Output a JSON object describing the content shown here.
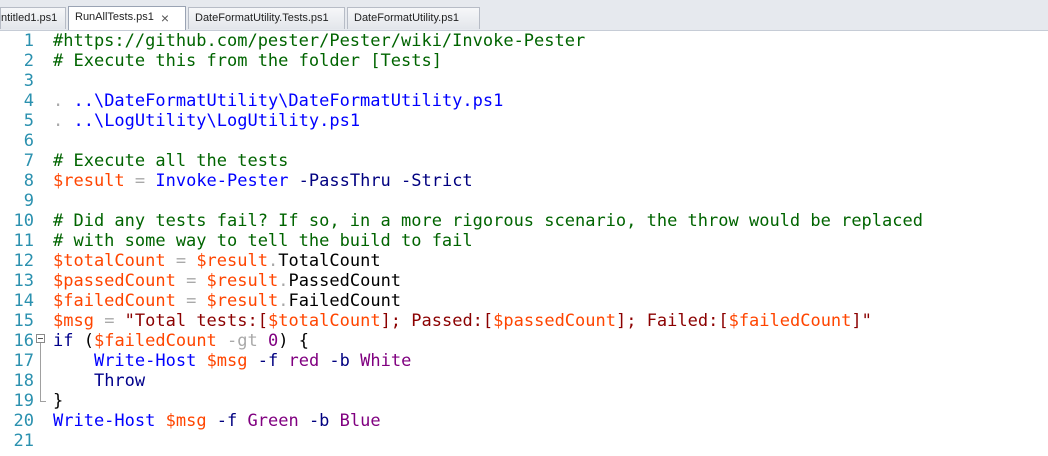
{
  "tabs": [
    {
      "label": "ntitled1.ps1",
      "active": false
    },
    {
      "label": "RunAllTests.ps1",
      "active": true,
      "close": "×"
    },
    {
      "label": "DateFormatUtility.Tests.ps1",
      "active": false
    },
    {
      "label": "DateFormatUtility.ps1",
      "active": false
    }
  ],
  "editor": {
    "lines": [
      {
        "n": "1",
        "tokens": [
          {
            "t": "#https://github.com/pester/Pester/wiki/Invoke-Pester",
            "c": "comment"
          }
        ]
      },
      {
        "n": "2",
        "tokens": [
          {
            "t": "# Execute this from the folder [Tests]",
            "c": "comment"
          }
        ]
      },
      {
        "n": "3",
        "tokens": []
      },
      {
        "n": "4",
        "tokens": [
          {
            "t": ". ",
            "c": "op"
          },
          {
            "t": "..\\DateFormatUtility\\DateFormatUtility.ps1",
            "c": "cmd"
          }
        ]
      },
      {
        "n": "5",
        "tokens": [
          {
            "t": ". ",
            "c": "op"
          },
          {
            "t": "..\\LogUtility\\LogUtility.ps1",
            "c": "cmd"
          }
        ]
      },
      {
        "n": "6",
        "tokens": []
      },
      {
        "n": "7",
        "tokens": [
          {
            "t": "# Execute all the tests",
            "c": "comment"
          }
        ]
      },
      {
        "n": "8",
        "tokens": [
          {
            "t": "$result",
            "c": "var"
          },
          {
            "t": " = ",
            "c": "op"
          },
          {
            "t": "Invoke-Pester",
            "c": "cmd"
          },
          {
            "t": " -PassThru -Strict",
            "c": "param"
          }
        ]
      },
      {
        "n": "9",
        "tokens": []
      },
      {
        "n": "10",
        "tokens": [
          {
            "t": "# Did any tests fail? If so, in a more rigorous scenario, the throw would be replaced",
            "c": "comment"
          }
        ]
      },
      {
        "n": "11",
        "tokens": [
          {
            "t": "# with some way to tell the build to fail",
            "c": "comment"
          }
        ]
      },
      {
        "n": "12",
        "tokens": [
          {
            "t": "$totalCount",
            "c": "var"
          },
          {
            "t": " = ",
            "c": "op"
          },
          {
            "t": "$result",
            "c": "var"
          },
          {
            "t": ".",
            "c": "op"
          },
          {
            "t": "TotalCount",
            "c": "member"
          }
        ]
      },
      {
        "n": "13",
        "tokens": [
          {
            "t": "$passedCount",
            "c": "var"
          },
          {
            "t": " = ",
            "c": "op"
          },
          {
            "t": "$result",
            "c": "var"
          },
          {
            "t": ".",
            "c": "op"
          },
          {
            "t": "PassedCount",
            "c": "member"
          }
        ]
      },
      {
        "n": "14",
        "tokens": [
          {
            "t": "$failedCount",
            "c": "var"
          },
          {
            "t": " = ",
            "c": "op"
          },
          {
            "t": "$result",
            "c": "var"
          },
          {
            "t": ".",
            "c": "op"
          },
          {
            "t": "FailedCount",
            "c": "member"
          }
        ]
      },
      {
        "n": "15",
        "tokens": [
          {
            "t": "$msg",
            "c": "var"
          },
          {
            "t": " = ",
            "c": "op"
          },
          {
            "t": "\"Total tests:[",
            "c": "str"
          },
          {
            "t": "$totalCount",
            "c": "var"
          },
          {
            "t": "]; Passed:[",
            "c": "str"
          },
          {
            "t": "$passedCount",
            "c": "var"
          },
          {
            "t": "]; Failed:[",
            "c": "str"
          },
          {
            "t": "$failedCount",
            "c": "var"
          },
          {
            "t": "]\"",
            "c": "str"
          }
        ]
      },
      {
        "n": "16",
        "tokens": [
          {
            "t": "if",
            "c": "kw"
          },
          {
            "t": " (",
            "c": "plain"
          },
          {
            "t": "$failedCount",
            "c": "var"
          },
          {
            "t": " -gt ",
            "c": "op"
          },
          {
            "t": "0",
            "c": "num"
          },
          {
            "t": ") {",
            "c": "plain"
          }
        ],
        "fold": true
      },
      {
        "n": "17",
        "tokens": [
          {
            "t": "    ",
            "c": "plain"
          },
          {
            "t": "Write-Host",
            "c": "cmd"
          },
          {
            "t": " ",
            "c": "plain"
          },
          {
            "t": "$msg",
            "c": "var"
          },
          {
            "t": " -f ",
            "c": "param"
          },
          {
            "t": "red",
            "c": "num"
          },
          {
            "t": " -b ",
            "c": "param"
          },
          {
            "t": "White",
            "c": "num"
          }
        ]
      },
      {
        "n": "18",
        "tokens": [
          {
            "t": "    ",
            "c": "plain"
          },
          {
            "t": "Throw",
            "c": "kw"
          }
        ]
      },
      {
        "n": "19",
        "tokens": [
          {
            "t": "}",
            "c": "plain"
          }
        ],
        "foldEnd": true
      },
      {
        "n": "20",
        "tokens": [
          {
            "t": "Write-Host",
            "c": "cmd"
          },
          {
            "t": " ",
            "c": "plain"
          },
          {
            "t": "$msg",
            "c": "var"
          },
          {
            "t": " -f ",
            "c": "param"
          },
          {
            "t": "Green",
            "c": "num"
          },
          {
            "t": " -b ",
            "c": "param"
          },
          {
            "t": "Blue",
            "c": "num"
          }
        ]
      },
      {
        "n": "21",
        "tokens": []
      }
    ]
  }
}
